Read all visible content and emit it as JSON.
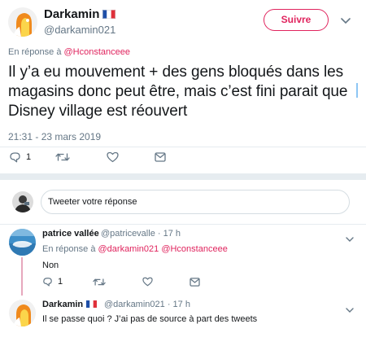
{
  "main_tweet": {
    "author_name": "Darkamin",
    "author_handle": "@darkamin021",
    "follow_label": "Suivre",
    "reply_prefix": "En réponse à",
    "reply_mention": "@Hconstanceee",
    "text": "Il y’a eu mouvement + des gens bloqués dans les magasins donc peut être, mais c’est fini parait que Disney village est réouvert",
    "timestamp": "21:31 - 23 mars 2019",
    "reply_count": "1",
    "icons": {
      "reply": "reply-icon",
      "retweet": "retweet-icon",
      "like": "heart-icon",
      "dm": "message-icon",
      "menu": "chevron-down-icon",
      "flag": "french-flag-icon"
    }
  },
  "composer": {
    "placeholder": "Tweeter votre réponse"
  },
  "replies": [
    {
      "author_name": "patrice vallée",
      "author_handle": "@patricevalle",
      "time": "· 17 h",
      "reply_prefix": "En réponse à",
      "mentions": "@darkamin021 @Hconstanceee",
      "text": "Non",
      "reply_count": "1"
    },
    {
      "author_name": "Darkamin",
      "author_handle": "@darkamin021",
      "time": "· 17 h",
      "text": "Il se passe quoi ? J’ai pas de source à part des tweets"
    }
  ],
  "colors": {
    "accent": "#e0245e",
    "muted": "#657786",
    "text": "#14171a",
    "border": "#e6ecf0"
  }
}
